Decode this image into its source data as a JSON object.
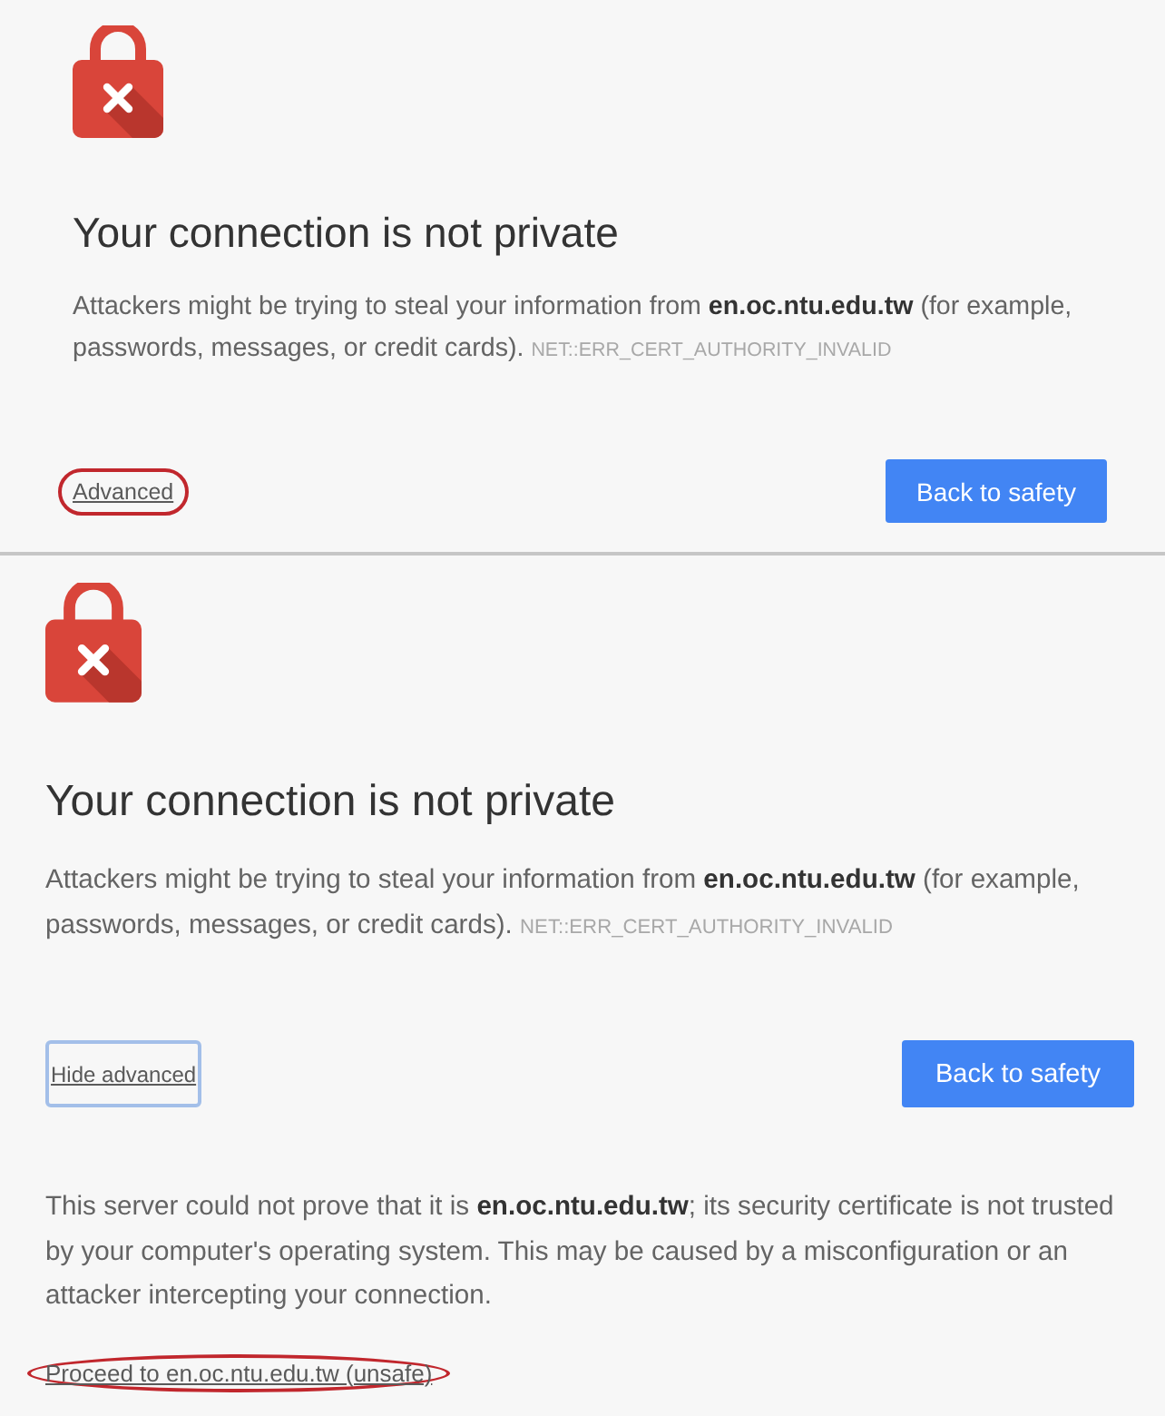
{
  "panels": [
    {
      "title": "Your connection is not private",
      "message": "Attackers might be trying to steal your information from **en.oc.ntu.edu.tw** (for example, passwords, messages, or credit cards).",
      "error_code": "NET::ERR_CERT_AUTHORITY_INVALID",
      "advanced_button": {
        "label": "Advanced",
        "focused": false,
        "highlighted": true
      },
      "primary_button": {
        "label": "Back to safety"
      }
    },
    {
      "title": "Your connection is not private",
      "message": "Attackers might be trying to steal your information from **en.oc.ntu.edu.tw** (for example, passwords, messages, or credit cards).",
      "error_code": "NET::ERR_CERT_AUTHORITY_INVALID",
      "advanced_button": {
        "label": "Hide advanced",
        "focused": true,
        "highlighted": false
      },
      "primary_button": {
        "label": "Back to safety"
      },
      "details": "This server could not prove that it is **en.oc.ntu.edu.tw**; its security certificate is not trusted by your computer's operating system. This may be caused by a misconfiguration or an attacker intercepting your connection.",
      "proceed_link": {
        "label": "Proceed to en.oc.ntu.edu.tw (unsafe)",
        "highlighted": true
      }
    }
  ]
}
